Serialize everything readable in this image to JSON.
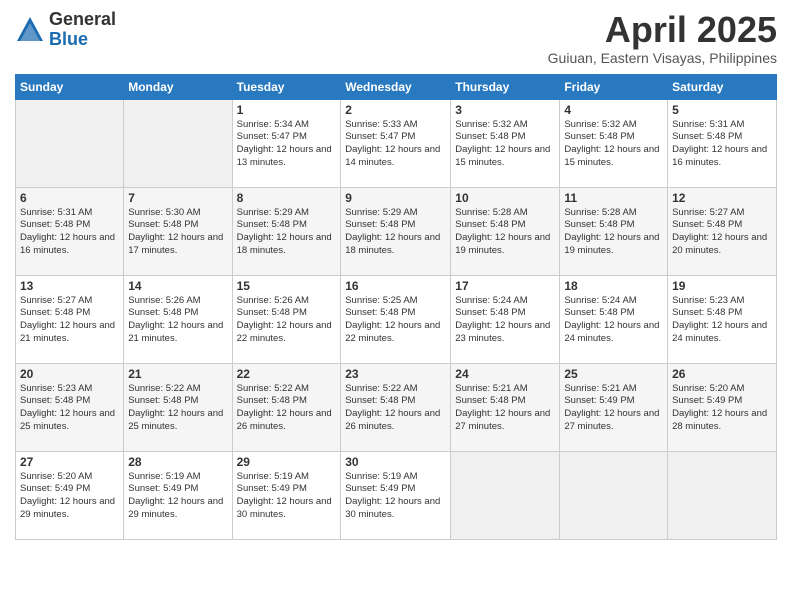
{
  "logo": {
    "general": "General",
    "blue": "Blue"
  },
  "title": "April 2025",
  "subtitle": "Guiuan, Eastern Visayas, Philippines",
  "days_of_week": [
    "Sunday",
    "Monday",
    "Tuesday",
    "Wednesday",
    "Thursday",
    "Friday",
    "Saturday"
  ],
  "weeks": [
    [
      {
        "day": "",
        "info": ""
      },
      {
        "day": "",
        "info": ""
      },
      {
        "day": "1",
        "info": "Sunrise: 5:34 AM\nSunset: 5:47 PM\nDaylight: 12 hours and 13 minutes."
      },
      {
        "day": "2",
        "info": "Sunrise: 5:33 AM\nSunset: 5:47 PM\nDaylight: 12 hours and 14 minutes."
      },
      {
        "day": "3",
        "info": "Sunrise: 5:32 AM\nSunset: 5:48 PM\nDaylight: 12 hours and 15 minutes."
      },
      {
        "day": "4",
        "info": "Sunrise: 5:32 AM\nSunset: 5:48 PM\nDaylight: 12 hours and 15 minutes."
      },
      {
        "day": "5",
        "info": "Sunrise: 5:31 AM\nSunset: 5:48 PM\nDaylight: 12 hours and 16 minutes."
      }
    ],
    [
      {
        "day": "6",
        "info": "Sunrise: 5:31 AM\nSunset: 5:48 PM\nDaylight: 12 hours and 16 minutes."
      },
      {
        "day": "7",
        "info": "Sunrise: 5:30 AM\nSunset: 5:48 PM\nDaylight: 12 hours and 17 minutes."
      },
      {
        "day": "8",
        "info": "Sunrise: 5:29 AM\nSunset: 5:48 PM\nDaylight: 12 hours and 18 minutes."
      },
      {
        "day": "9",
        "info": "Sunrise: 5:29 AM\nSunset: 5:48 PM\nDaylight: 12 hours and 18 minutes."
      },
      {
        "day": "10",
        "info": "Sunrise: 5:28 AM\nSunset: 5:48 PM\nDaylight: 12 hours and 19 minutes."
      },
      {
        "day": "11",
        "info": "Sunrise: 5:28 AM\nSunset: 5:48 PM\nDaylight: 12 hours and 19 minutes."
      },
      {
        "day": "12",
        "info": "Sunrise: 5:27 AM\nSunset: 5:48 PM\nDaylight: 12 hours and 20 minutes."
      }
    ],
    [
      {
        "day": "13",
        "info": "Sunrise: 5:27 AM\nSunset: 5:48 PM\nDaylight: 12 hours and 21 minutes."
      },
      {
        "day": "14",
        "info": "Sunrise: 5:26 AM\nSunset: 5:48 PM\nDaylight: 12 hours and 21 minutes."
      },
      {
        "day": "15",
        "info": "Sunrise: 5:26 AM\nSunset: 5:48 PM\nDaylight: 12 hours and 22 minutes."
      },
      {
        "day": "16",
        "info": "Sunrise: 5:25 AM\nSunset: 5:48 PM\nDaylight: 12 hours and 22 minutes."
      },
      {
        "day": "17",
        "info": "Sunrise: 5:24 AM\nSunset: 5:48 PM\nDaylight: 12 hours and 23 minutes."
      },
      {
        "day": "18",
        "info": "Sunrise: 5:24 AM\nSunset: 5:48 PM\nDaylight: 12 hours and 24 minutes."
      },
      {
        "day": "19",
        "info": "Sunrise: 5:23 AM\nSunset: 5:48 PM\nDaylight: 12 hours and 24 minutes."
      }
    ],
    [
      {
        "day": "20",
        "info": "Sunrise: 5:23 AM\nSunset: 5:48 PM\nDaylight: 12 hours and 25 minutes."
      },
      {
        "day": "21",
        "info": "Sunrise: 5:22 AM\nSunset: 5:48 PM\nDaylight: 12 hours and 25 minutes."
      },
      {
        "day": "22",
        "info": "Sunrise: 5:22 AM\nSunset: 5:48 PM\nDaylight: 12 hours and 26 minutes."
      },
      {
        "day": "23",
        "info": "Sunrise: 5:22 AM\nSunset: 5:48 PM\nDaylight: 12 hours and 26 minutes."
      },
      {
        "day": "24",
        "info": "Sunrise: 5:21 AM\nSunset: 5:48 PM\nDaylight: 12 hours and 27 minutes."
      },
      {
        "day": "25",
        "info": "Sunrise: 5:21 AM\nSunset: 5:49 PM\nDaylight: 12 hours and 27 minutes."
      },
      {
        "day": "26",
        "info": "Sunrise: 5:20 AM\nSunset: 5:49 PM\nDaylight: 12 hours and 28 minutes."
      }
    ],
    [
      {
        "day": "27",
        "info": "Sunrise: 5:20 AM\nSunset: 5:49 PM\nDaylight: 12 hours and 29 minutes."
      },
      {
        "day": "28",
        "info": "Sunrise: 5:19 AM\nSunset: 5:49 PM\nDaylight: 12 hours and 29 minutes."
      },
      {
        "day": "29",
        "info": "Sunrise: 5:19 AM\nSunset: 5:49 PM\nDaylight: 12 hours and 30 minutes."
      },
      {
        "day": "30",
        "info": "Sunrise: 5:19 AM\nSunset: 5:49 PM\nDaylight: 12 hours and 30 minutes."
      },
      {
        "day": "",
        "info": ""
      },
      {
        "day": "",
        "info": ""
      },
      {
        "day": "",
        "info": ""
      }
    ]
  ]
}
